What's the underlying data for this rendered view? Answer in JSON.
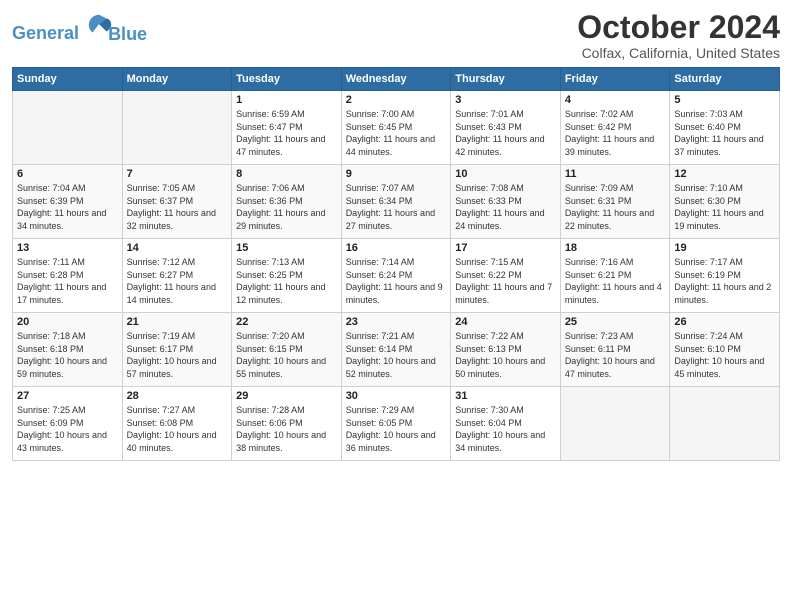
{
  "header": {
    "logo_line1": "General",
    "logo_line2": "Blue",
    "month": "October 2024",
    "location": "Colfax, California, United States"
  },
  "days_of_week": [
    "Sunday",
    "Monday",
    "Tuesday",
    "Wednesday",
    "Thursday",
    "Friday",
    "Saturday"
  ],
  "weeks": [
    [
      {
        "day": "",
        "empty": true
      },
      {
        "day": "",
        "empty": true
      },
      {
        "day": "1",
        "sunrise": "6:59 AM",
        "sunset": "6:47 PM",
        "daylight": "11 hours and 47 minutes."
      },
      {
        "day": "2",
        "sunrise": "7:00 AM",
        "sunset": "6:45 PM",
        "daylight": "11 hours and 44 minutes."
      },
      {
        "day": "3",
        "sunrise": "7:01 AM",
        "sunset": "6:43 PM",
        "daylight": "11 hours and 42 minutes."
      },
      {
        "day": "4",
        "sunrise": "7:02 AM",
        "sunset": "6:42 PM",
        "daylight": "11 hours and 39 minutes."
      },
      {
        "day": "5",
        "sunrise": "7:03 AM",
        "sunset": "6:40 PM",
        "daylight": "11 hours and 37 minutes."
      }
    ],
    [
      {
        "day": "6",
        "sunrise": "7:04 AM",
        "sunset": "6:39 PM",
        "daylight": "11 hours and 34 minutes."
      },
      {
        "day": "7",
        "sunrise": "7:05 AM",
        "sunset": "6:37 PM",
        "daylight": "11 hours and 32 minutes."
      },
      {
        "day": "8",
        "sunrise": "7:06 AM",
        "sunset": "6:36 PM",
        "daylight": "11 hours and 29 minutes."
      },
      {
        "day": "9",
        "sunrise": "7:07 AM",
        "sunset": "6:34 PM",
        "daylight": "11 hours and 27 minutes."
      },
      {
        "day": "10",
        "sunrise": "7:08 AM",
        "sunset": "6:33 PM",
        "daylight": "11 hours and 24 minutes."
      },
      {
        "day": "11",
        "sunrise": "7:09 AM",
        "sunset": "6:31 PM",
        "daylight": "11 hours and 22 minutes."
      },
      {
        "day": "12",
        "sunrise": "7:10 AM",
        "sunset": "6:30 PM",
        "daylight": "11 hours and 19 minutes."
      }
    ],
    [
      {
        "day": "13",
        "sunrise": "7:11 AM",
        "sunset": "6:28 PM",
        "daylight": "11 hours and 17 minutes."
      },
      {
        "day": "14",
        "sunrise": "7:12 AM",
        "sunset": "6:27 PM",
        "daylight": "11 hours and 14 minutes."
      },
      {
        "day": "15",
        "sunrise": "7:13 AM",
        "sunset": "6:25 PM",
        "daylight": "11 hours and 12 minutes."
      },
      {
        "day": "16",
        "sunrise": "7:14 AM",
        "sunset": "6:24 PM",
        "daylight": "11 hours and 9 minutes."
      },
      {
        "day": "17",
        "sunrise": "7:15 AM",
        "sunset": "6:22 PM",
        "daylight": "11 hours and 7 minutes."
      },
      {
        "day": "18",
        "sunrise": "7:16 AM",
        "sunset": "6:21 PM",
        "daylight": "11 hours and 4 minutes."
      },
      {
        "day": "19",
        "sunrise": "7:17 AM",
        "sunset": "6:19 PM",
        "daylight": "11 hours and 2 minutes."
      }
    ],
    [
      {
        "day": "20",
        "sunrise": "7:18 AM",
        "sunset": "6:18 PM",
        "daylight": "10 hours and 59 minutes."
      },
      {
        "day": "21",
        "sunrise": "7:19 AM",
        "sunset": "6:17 PM",
        "daylight": "10 hours and 57 minutes."
      },
      {
        "day": "22",
        "sunrise": "7:20 AM",
        "sunset": "6:15 PM",
        "daylight": "10 hours and 55 minutes."
      },
      {
        "day": "23",
        "sunrise": "7:21 AM",
        "sunset": "6:14 PM",
        "daylight": "10 hours and 52 minutes."
      },
      {
        "day": "24",
        "sunrise": "7:22 AM",
        "sunset": "6:13 PM",
        "daylight": "10 hours and 50 minutes."
      },
      {
        "day": "25",
        "sunrise": "7:23 AM",
        "sunset": "6:11 PM",
        "daylight": "10 hours and 47 minutes."
      },
      {
        "day": "26",
        "sunrise": "7:24 AM",
        "sunset": "6:10 PM",
        "daylight": "10 hours and 45 minutes."
      }
    ],
    [
      {
        "day": "27",
        "sunrise": "7:25 AM",
        "sunset": "6:09 PM",
        "daylight": "10 hours and 43 minutes."
      },
      {
        "day": "28",
        "sunrise": "7:27 AM",
        "sunset": "6:08 PM",
        "daylight": "10 hours and 40 minutes."
      },
      {
        "day": "29",
        "sunrise": "7:28 AM",
        "sunset": "6:06 PM",
        "daylight": "10 hours and 38 minutes."
      },
      {
        "day": "30",
        "sunrise": "7:29 AM",
        "sunset": "6:05 PM",
        "daylight": "10 hours and 36 minutes."
      },
      {
        "day": "31",
        "sunrise": "7:30 AM",
        "sunset": "6:04 PM",
        "daylight": "10 hours and 34 minutes."
      },
      {
        "day": "",
        "empty": true
      },
      {
        "day": "",
        "empty": true
      }
    ]
  ]
}
